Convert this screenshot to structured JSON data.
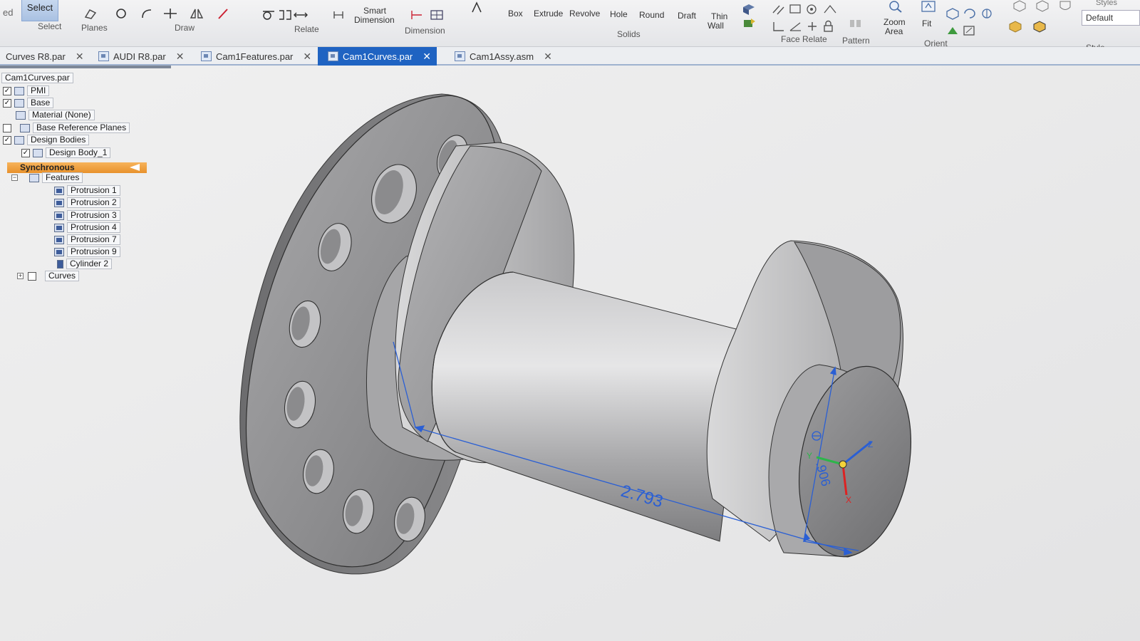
{
  "ribbon": {
    "select_button": "Select",
    "groups": {
      "select": "Select",
      "planes": "Planes",
      "draw": "Draw",
      "relate": "Relate",
      "dimension": "Dimension",
      "solids": "Solids",
      "face_relate": "Face Relate",
      "pattern": "Pattern",
      "orient": "Orient",
      "style": "Style"
    },
    "truncated_left_label": "ed",
    "commands": {
      "smart_dimension_line1": "Smart",
      "smart_dimension_line2": "Dimension",
      "box": "Box",
      "extrude": "Extrude",
      "revolve": "Revolve",
      "hole": "Hole",
      "round": "Round",
      "draft": "Draft",
      "thin_wall_line1": "Thin",
      "thin_wall_line2": "Wall",
      "zoom_area_line1": "Zoom",
      "zoom_area_line2": "Area",
      "fit": "Fit"
    },
    "styles_label": "Styles",
    "style_value": "Default"
  },
  "tabs": [
    {
      "label": "Curves R8.par",
      "active": false
    },
    {
      "label": "AUDI R8.par",
      "active": false
    },
    {
      "label": "Cam1Features.par",
      "active": false
    },
    {
      "label": "Cam1Curves.par",
      "active": true
    },
    {
      "label": "Cam1Assy.asm",
      "active": false
    }
  ],
  "tree": {
    "root": "Cam1Curves.par",
    "pmi": "PMI",
    "base": "Base",
    "material": "Material (None)",
    "base_reference_planes": "Base Reference Planes",
    "design_bodies": "Design Bodies",
    "design_body": "Design Body_1",
    "synchronous": "Synchronous",
    "features": "Features",
    "feature_items": [
      "Protrusion 1",
      "Protrusion 2",
      "Protrusion 3",
      "Protrusion 4",
      "Protrusion 7",
      "Protrusion 9",
      "Cylinder 2"
    ],
    "curves": "Curves"
  },
  "viewport": {
    "dimension_length": "2.793",
    "dimension_diameter": ".906",
    "axes": {
      "x": "X",
      "y": "Y",
      "z": "Z"
    },
    "colors": {
      "highlight": "#1f63c2",
      "dimension": "#2a5fd4",
      "sync_bar": "#e8912b",
      "part_gray": "#9a9a9c",
      "background": "#e9e9ea"
    }
  }
}
